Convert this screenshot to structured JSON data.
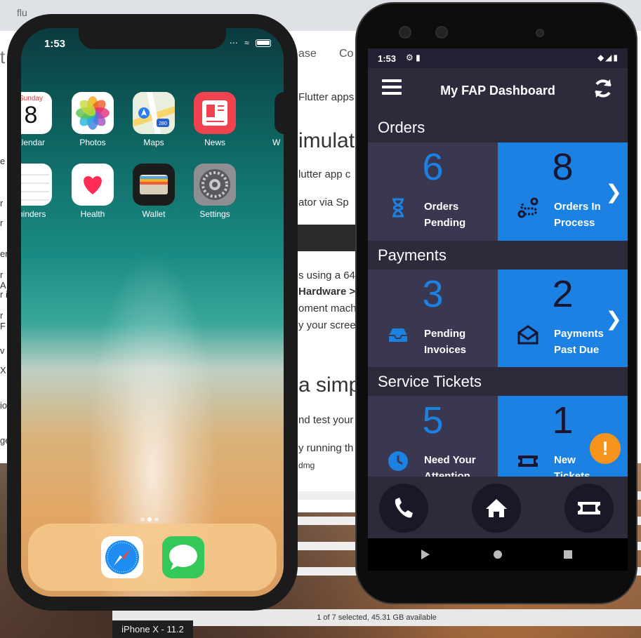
{
  "desktop": {
    "browser_url": "flu",
    "browser_tabs": [
      "ase",
      "Co"
    ],
    "left_fragments": [
      "t",
      "e",
      "r",
      "r",
      "er",
      "r A",
      "r i",
      "r F",
      "v",
      "X",
      "io",
      "ge"
    ],
    "doc_lines": [
      "Flutter apps",
      "imulat",
      "lutter app c",
      "ator via Sp",
      "s using a 64",
      "Hardware >",
      "oment mach",
      "y your scree",
      "a simp",
      "nd test your",
      "y running th",
      "dmg"
    ],
    "finder_status": "1 of 7 selected, 45.31 GB available",
    "simulator_caption": "iPhone X - 11.2"
  },
  "ios": {
    "time": "1:53",
    "calendar_day": "Sunday",
    "calendar_date": "8",
    "apps_row1": [
      "alendar",
      "Photos",
      "Maps",
      "News",
      "W"
    ],
    "apps_row2": [
      "minders",
      "Health",
      "Wallet",
      "Settings"
    ],
    "maps_badge": "280",
    "dock_apps": [
      "Safari",
      "Messages"
    ]
  },
  "android": {
    "time": "1:53",
    "app_title": "My FAP Dashboard",
    "sections": [
      {
        "title": "Orders",
        "cards": [
          {
            "count": "6",
            "label_line1": "Orders",
            "label_line2": "Pending",
            "icon": "hourglass-icon"
          },
          {
            "count": "8",
            "label_line1": "Orders In",
            "label_line2": "Process",
            "icon": "route-icon"
          }
        ]
      },
      {
        "title": "Payments",
        "cards": [
          {
            "count": "3",
            "label_line1": "Pending",
            "label_line2": "Invoices",
            "icon": "inbox-icon"
          },
          {
            "count": "2",
            "label_line1": "Payments",
            "label_line2": "Past Due",
            "icon": "envelope-open-icon"
          }
        ]
      },
      {
        "title": "Service Tickets",
        "cards": [
          {
            "count": "5",
            "label_line1": "Need Your",
            "label_line2": "Attention",
            "icon": "clock-icon"
          },
          {
            "count": "1",
            "label_line1": "New",
            "label_line2": "Tickets",
            "icon": "ticket-icon"
          }
        ]
      }
    ],
    "fab_label": "!",
    "colors": {
      "accent_blue": "#1b82e3",
      "background": "#2d2a3c",
      "card_dark": "#3a3850",
      "fab": "#f7941d"
    }
  }
}
